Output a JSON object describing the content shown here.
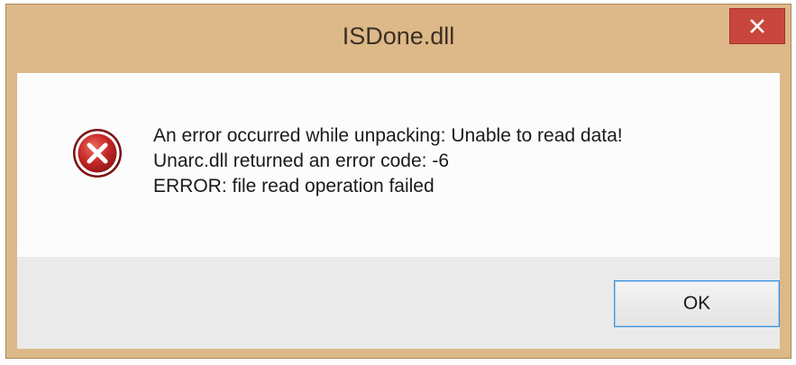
{
  "window": {
    "title": "ISDone.dll"
  },
  "titlebar": {
    "close_icon": "close-icon",
    "close_color": "#c9463d"
  },
  "message": {
    "icon": "error-icon",
    "icon_color": "#c62828",
    "lines": [
      "An error occurred while unpacking: Unable to read data!",
      "Unarc.dll returned an error code: -6",
      "ERROR: file read operation failed"
    ]
  },
  "buttons": {
    "ok_label": "OK"
  },
  "colors": {
    "frame": "#ddb888",
    "focus_border": "#3a8fd9"
  }
}
